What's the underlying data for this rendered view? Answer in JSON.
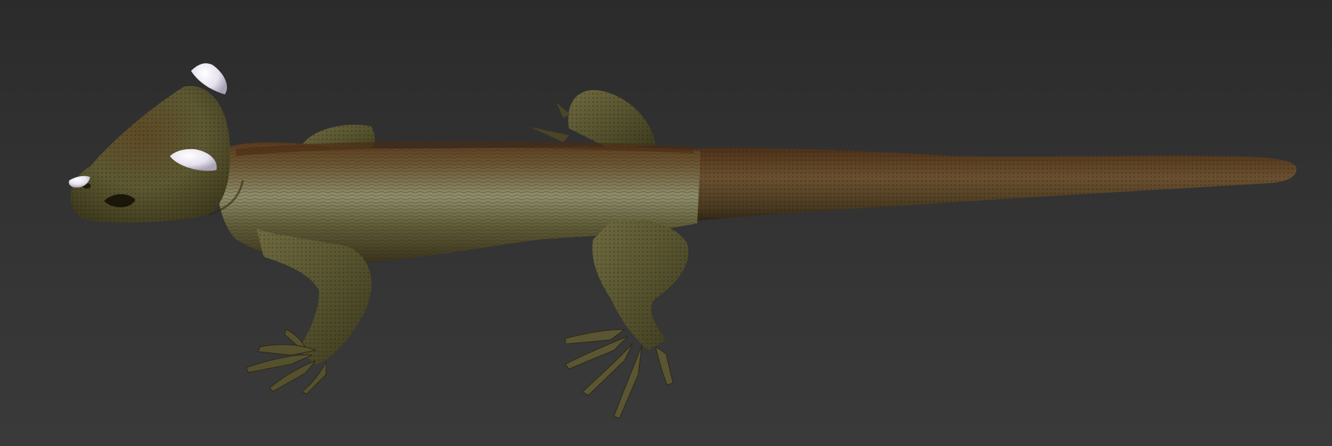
{
  "viewport": {
    "background_top": "#2b2b2b",
    "background_bottom": "#3a3a3a"
  },
  "model": {
    "subject": "lizard",
    "skin_color": "#5c5a34",
    "back_stripe_color": "#5a3a1c",
    "highlight_color": "#a9a98a",
    "horn_color": "#e9e6f0"
  }
}
